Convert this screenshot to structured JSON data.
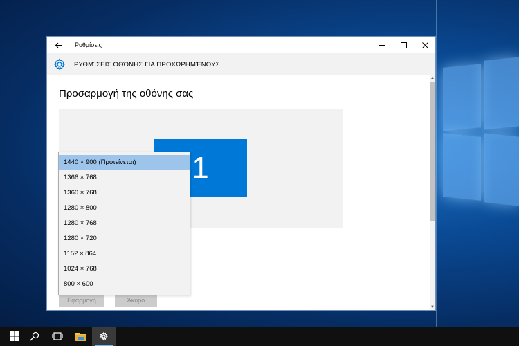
{
  "window": {
    "title": "Ρυθμίσεις",
    "header_title": "ΡΥΘΜΊΣΕΙΣ ΟΘΌΝΗΣ ΓΙΑ ΠΡΟΧΩΡΗΜΈΝΟΥΣ"
  },
  "page": {
    "title": "Προσαρμογή της οθόνης σας",
    "monitor_label": "1"
  },
  "buttons": {
    "apply": "Εφαρμογή",
    "cancel": "Άκυρο"
  },
  "resolution_dropdown": {
    "selected_index": 0,
    "options": [
      "1440 × 900 (Προτείνεται)",
      "1366 × 768",
      "1360 × 768",
      "1280 × 800",
      "1280 × 768",
      "1280 × 720",
      "1152 × 864",
      "1024 × 768",
      "800 × 600"
    ]
  },
  "taskbar": {
    "items": [
      "windows-start-icon",
      "search-icon",
      "task-view-icon",
      "file-explorer-icon",
      "settings-icon"
    ]
  },
  "colors": {
    "accent": "#0078d7",
    "selection": "#9dc4ea",
    "taskbar": "#101010"
  }
}
